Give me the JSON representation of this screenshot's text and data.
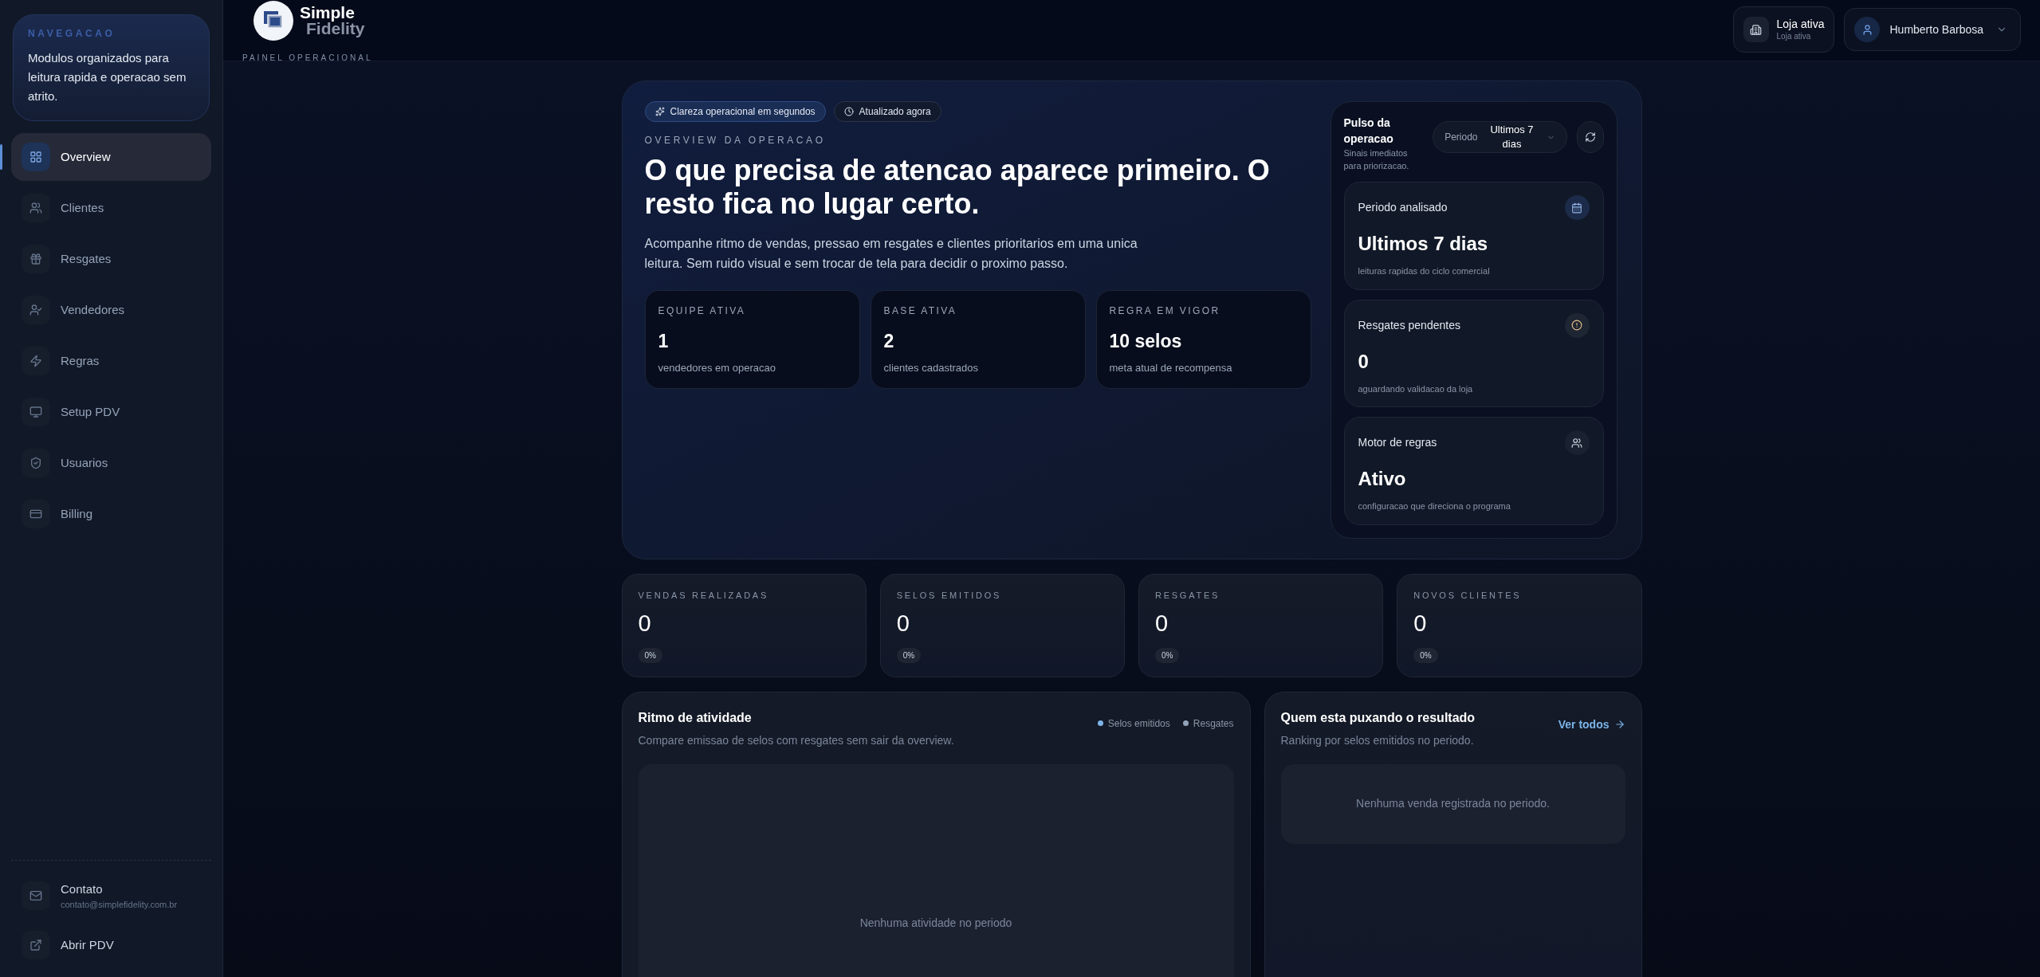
{
  "sidebar": {
    "intro": {
      "eyebrow": "NAVEGACAO",
      "text": "Modulos organizados para leitura rapida e operacao sem atrito."
    },
    "items": [
      {
        "label": "Overview",
        "selected": true
      },
      {
        "label": "Clientes",
        "selected": false
      },
      {
        "label": "Resgates",
        "selected": false
      },
      {
        "label": "Vendedores",
        "selected": false
      },
      {
        "label": "Regras",
        "selected": false
      },
      {
        "label": "Setup PDV",
        "selected": false
      },
      {
        "label": "Usuarios",
        "selected": false
      },
      {
        "label": "Billing",
        "selected": false
      }
    ],
    "footer": [
      {
        "label": "Contato",
        "sub": "contato@simplefidelity.com.br"
      },
      {
        "label": "Abrir PDV"
      }
    ]
  },
  "header": {
    "logo": {
      "line1": "Simple",
      "line2": "Fidelity"
    },
    "section": "PAINEL OPERACIONAL",
    "store": {
      "title": "Loja ativa",
      "sub": "Loja ativa"
    },
    "user": "Humberto Barbosa"
  },
  "hero": {
    "chips": [
      "Clareza operacional em segundos",
      "Atualizado agora"
    ],
    "eyebrow": "OVERVIEW DA OPERACAO",
    "title": "O que precisa de atencao aparece primeiro. O resto fica no lugar certo.",
    "text": "Acompanhe ritmo de vendas, pressao em resgates e clientes prioritarios em uma unica leitura. Sem ruido visual e sem trocar de tela para decidir o proximo passo.",
    "stats": [
      {
        "label": "EQUIPE ATIVA",
        "value": "1",
        "sub": "vendedores em operacao"
      },
      {
        "label": "BASE ATIVA",
        "value": "2",
        "sub": "clientes cadastrados"
      },
      {
        "label": "REGRA EM VIGOR",
        "value": "10 selos",
        "sub": "meta atual de recompensa"
      }
    ]
  },
  "pulse": {
    "title": "Pulso da operacao",
    "sub": "Sinais imediatos para priorizacao.",
    "period_label": "Periodo",
    "period_value": "Ultimos 7 dias",
    "cards": [
      {
        "title": "Periodo analisado",
        "value": "Ultimos 7 dias",
        "sub": "leituras rapidas do ciclo comercial"
      },
      {
        "title": "Resgates pendentes",
        "value": "0",
        "sub": "aguardando validacao da loja"
      },
      {
        "title": "Motor de regras",
        "value": "Ativo",
        "sub": "configuracao que direciona o programa"
      }
    ]
  },
  "metrics": [
    {
      "label": "VENDAS REALIZADAS",
      "value": "0",
      "change": "0%"
    },
    {
      "label": "SELOS EMITIDOS",
      "value": "0",
      "change": "0%"
    },
    {
      "label": "RESGATES",
      "value": "0",
      "change": "0%"
    },
    {
      "label": "NOVOS CLIENTES",
      "value": "0",
      "change": "0%"
    }
  ],
  "activity": {
    "title": "Ritmo de atividade",
    "sub": "Compare emissao de selos com resgates sem sair da overview.",
    "legend": [
      {
        "label": "Selos emitidos",
        "color": "#7cb4e8"
      },
      {
        "label": "Resgates",
        "color": "#94a3b8"
      }
    ],
    "empty": "Nenhuma atividade no periodo"
  },
  "ranking": {
    "title": "Quem esta puxando o resultado",
    "sub": "Ranking por selos emitidos no periodo.",
    "link": "Ver todos",
    "empty": "Nenhuma venda registrada no periodo."
  }
}
